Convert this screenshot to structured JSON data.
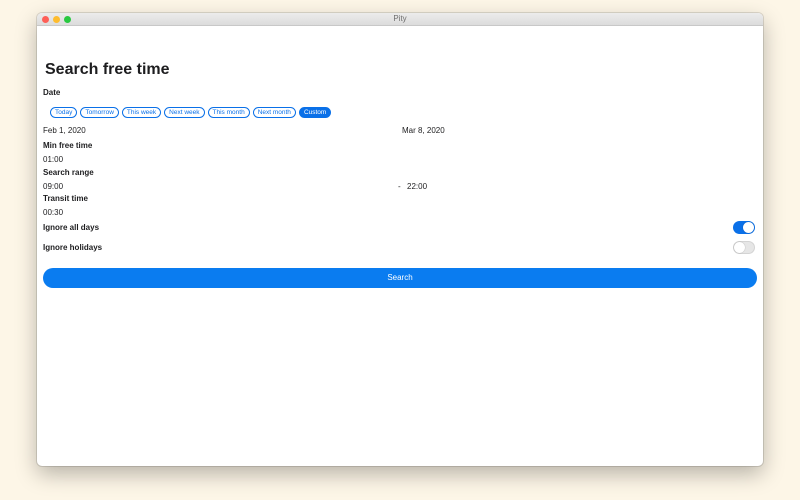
{
  "window": {
    "title": "Pity"
  },
  "page": {
    "title": "Search free time"
  },
  "date": {
    "label": "Date",
    "chips": [
      "Today",
      "Tomorrow",
      "This week",
      "Next week",
      "This month",
      "Next month",
      "Custom"
    ],
    "active_chip": "Custom",
    "start": "Feb 1, 2020",
    "end": "Mar 8, 2020"
  },
  "min_free_time": {
    "label": "Min free time",
    "value": "01:00"
  },
  "search_range": {
    "label": "Search range",
    "start": "09:00",
    "separator": "-",
    "end": "22:00"
  },
  "transit_time": {
    "label": "Transit time",
    "value": "00:30"
  },
  "ignore_all_days": {
    "label": "Ignore all days",
    "enabled": true
  },
  "ignore_holidays": {
    "label": "Ignore holidays",
    "enabled": false
  },
  "search_button": {
    "label": "Search"
  },
  "colors": {
    "accent": "#0a70e8",
    "background": "#fdf6e7"
  }
}
